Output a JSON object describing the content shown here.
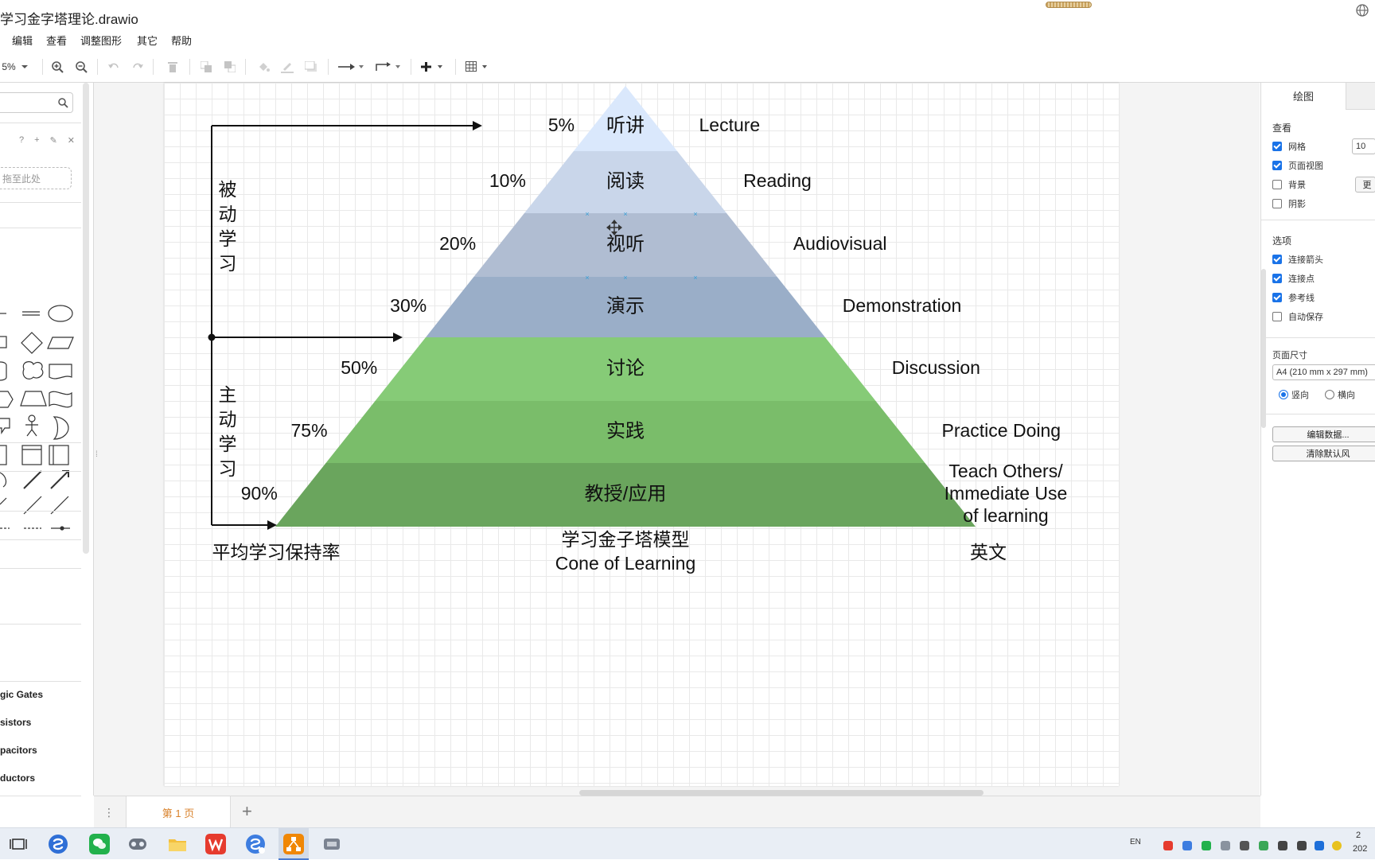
{
  "window": {
    "title": "学习金字塔理论.drawio"
  },
  "menu": [
    "编辑",
    "查看",
    "调整图形",
    "其它",
    "帮助"
  ],
  "toolbar": {
    "zoom": "5%"
  },
  "left_panel": {
    "scratchpad_drop_hint": "拖至此处",
    "scratch_tools": [
      "?",
      "+",
      "✎",
      "✕"
    ],
    "libraries": [
      "gic Gates",
      "sistors",
      "pacitors",
      "ductors"
    ]
  },
  "diagram": {
    "tiers": [
      {
        "label": "听讲",
        "percent": "5%",
        "english": [
          "Lecture"
        ],
        "color": "#dae8fc"
      },
      {
        "label": "阅读",
        "percent": "10%",
        "english": [
          "Reading"
        ],
        "color": "#c9d6ea"
      },
      {
        "label": "视听",
        "percent": "20%",
        "english": [
          "Audiovisual"
        ],
        "color": "#b0bdd2"
      },
      {
        "label": "演示",
        "percent": "30%",
        "english": [
          "Demonstration"
        ],
        "color": "#9aaec8"
      },
      {
        "label": "讨论",
        "percent": "50%",
        "english": [
          "Discussion"
        ],
        "color": "#86cb77"
      },
      {
        "label": "实践",
        "percent": "75%",
        "english": [
          "Practice Doing"
        ],
        "color": "#7abd6a"
      },
      {
        "label": "教授/应用",
        "percent": "90%",
        "english": [
          "Teach Others/",
          "Immediate Use",
          "of learning"
        ],
        "color": "#6aa55d"
      }
    ],
    "passive_label": [
      "被",
      "动",
      "学",
      "习"
    ],
    "active_label": [
      "主",
      "动",
      "学",
      "习"
    ],
    "caption_left": "平均学习保持率",
    "caption_center_line1": "学习金子塔模型",
    "caption_center_line2": "Cone of Learning",
    "caption_right": "英文"
  },
  "right_panel": {
    "tab": "绘图",
    "view_section": "查看",
    "view_options": [
      {
        "label": "网格",
        "checked": true
      },
      {
        "label": "页面视图",
        "checked": true
      },
      {
        "label": "背景",
        "checked": false
      },
      {
        "label": "阴影",
        "checked": false
      }
    ],
    "grid_size": "10",
    "background_button": "更",
    "options_section": "选项",
    "options": [
      {
        "label": "连接箭头",
        "checked": true
      },
      {
        "label": "连接点",
        "checked": true
      },
      {
        "label": "参考线",
        "checked": true
      },
      {
        "label": "自动保存",
        "checked": false
      }
    ],
    "page_size_section": "页面尺寸",
    "page_size_value": "A4 (210 mm x 297 mm)",
    "orientation_portrait": "竖向",
    "orientation_landscape": "横向",
    "edit_data_button": "编辑数据...",
    "clear_style_button": "清除默认风"
  },
  "page_tabs": {
    "current": "第 1 页"
  },
  "taskbar": {
    "lang": "EN",
    "clock_line1": "2",
    "clock_line2": "202"
  }
}
